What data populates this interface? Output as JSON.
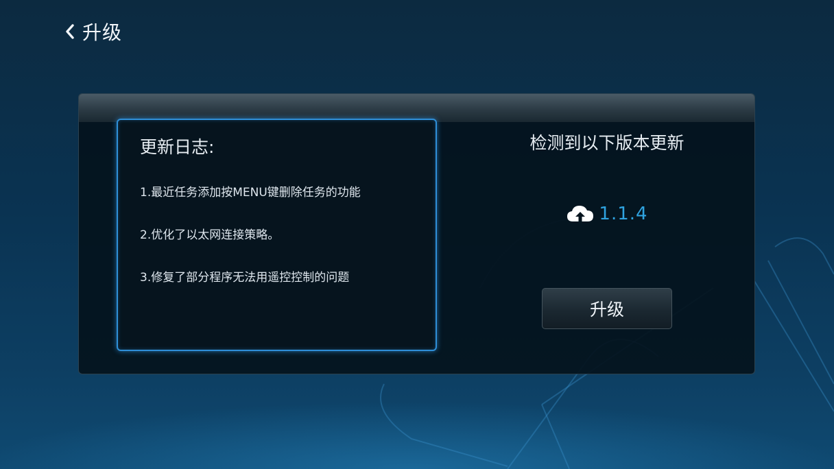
{
  "header": {
    "title": "升级",
    "back_icon": "chevron-left-icon"
  },
  "changelog": {
    "title": "更新日志:",
    "items": [
      "1.最近任务添加按MENU键删除任务的功能",
      "2.优化了以太网连接策略。",
      "3.修复了部分程序无法用遥控控制的问题"
    ]
  },
  "update": {
    "heading": "检测到以下版本更新",
    "version": "1.1.4",
    "version_icon": "cloud-upload-icon",
    "button_label": "升级"
  },
  "colors": {
    "accent": "#2fa3e0",
    "focus_border": "#2f8fd8",
    "background": "#0a3352"
  }
}
